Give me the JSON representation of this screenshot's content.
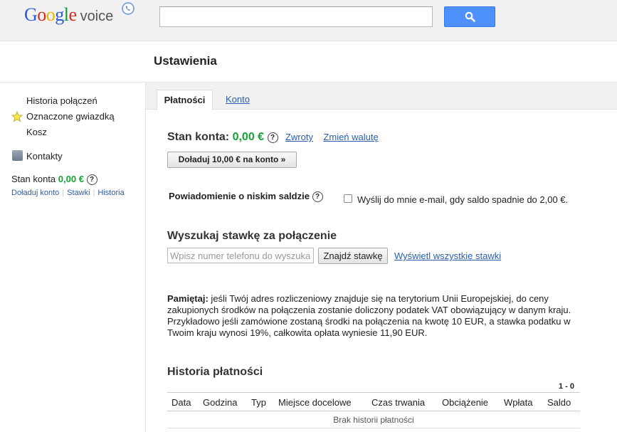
{
  "header": {
    "logo": {
      "G": "G",
      "o1": "o",
      "o2": "o",
      "g": "g",
      "l": "l",
      "e": "e",
      "product": "voice"
    },
    "search": {
      "value": "",
      "placeholder": ""
    }
  },
  "page": {
    "title": "Ustawienia"
  },
  "sidebar": {
    "items": [
      {
        "label": "Historia połączeń"
      },
      {
        "label": "Oznaczone gwiazdką"
      },
      {
        "label": "Kosz"
      },
      {
        "label": "Kontakty"
      }
    ],
    "balance_label": "Stan konta",
    "balance_value": "0,00 €",
    "help": "?",
    "links": [
      "Doładuj konto",
      "Stawki",
      "Historia"
    ],
    "separator": "|"
  },
  "tabs": [
    {
      "label": "Płatności",
      "active": true
    },
    {
      "label": "Konto",
      "active": false
    }
  ],
  "payments": {
    "balance_label": "Stan konta:",
    "balance_value": "0,00 €",
    "help": "?",
    "refunds_link": "Zwroty",
    "currency_link": "Zmień walutę",
    "topup_button": "Doładuj 10,00 €  na konto »",
    "low_balance": {
      "label": "Powiadomienie o niskim saldzie",
      "help": "?",
      "checkbox_label": "Wyślij do mnie e-mail, gdy saldo spadnie do 2,00 €.",
      "checked": false
    },
    "rate_search": {
      "heading": "Wyszukaj stawkę za połączenie",
      "placeholder": "Wpisz numer telefonu do wyszukania",
      "button": "Znajdź stawkę",
      "all_rates_link": "Wyświetl wszystkie stawki"
    },
    "note": {
      "bold": "Pamiętaj:",
      "text": " jeśli Twój adres rozliczeniowy znajduje się na terytorium Unii Europejskiej, do ceny zakupionych środków na połączenia zostanie doliczony podatek VAT obowiązujący w danym kraju. Przykładowo jeśli zamówione zostaną środki na połączenia na kwotę 10 EUR, a stawka podatku w Twoim kraju wynosi 19%, całkowita opłata wyniesie 11,90 EUR."
    },
    "history": {
      "heading": "Historia płatności",
      "count": "1 - 0",
      "columns": [
        "Data",
        "Godzina",
        "Typ",
        "Miejsce docelowe",
        "Czas trwania",
        "Obciążenie",
        "Wpłata",
        "Saldo"
      ],
      "empty": "Brak historii płatności"
    }
  },
  "colors": {
    "accent_green": "#15a336",
    "link_blue": "#2a5db0",
    "search_button": "#4d90fe"
  }
}
